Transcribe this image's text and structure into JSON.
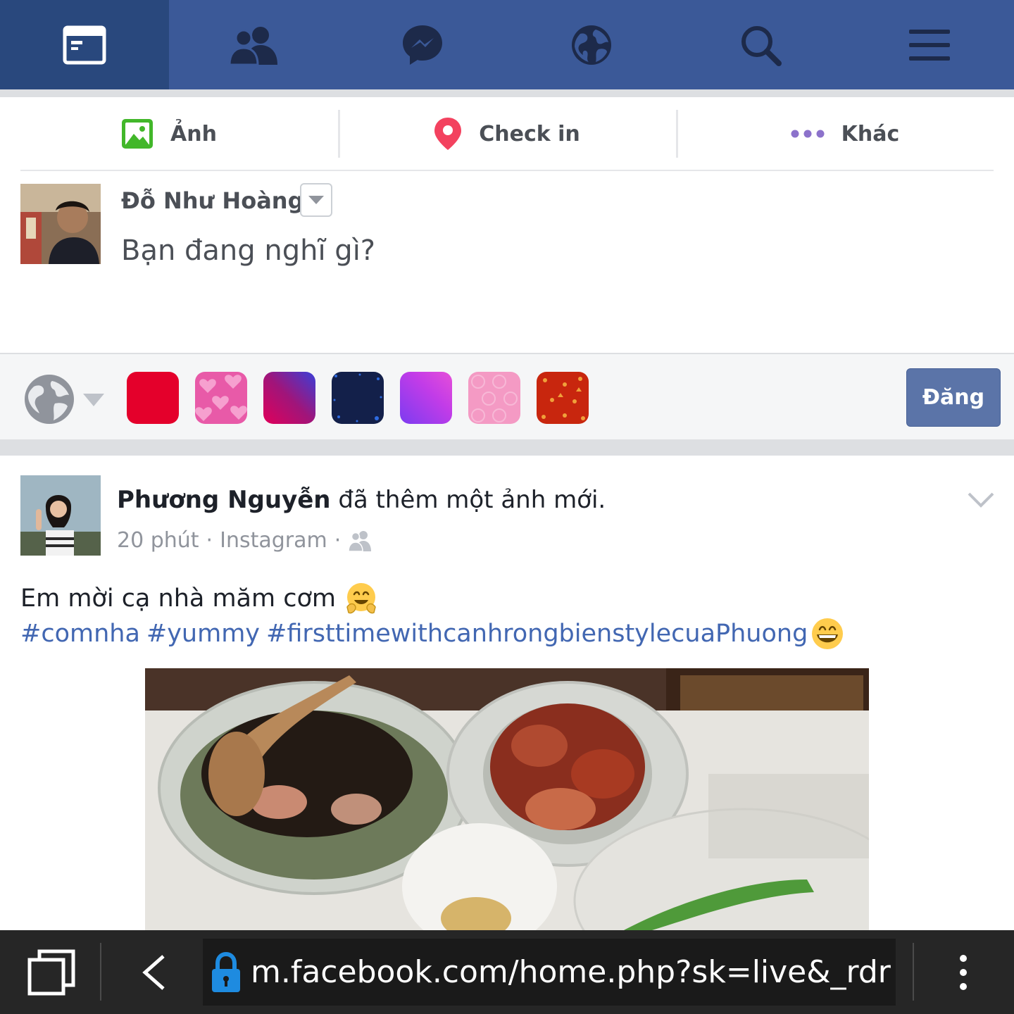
{
  "colors": {
    "brand": "#3b5998",
    "brand_active": "#29487d",
    "link": "#4267b2",
    "post_button": "#5b74a8"
  },
  "topnav": {
    "items": [
      {
        "icon": "news-feed-icon",
        "active": true
      },
      {
        "icon": "friends-icon",
        "active": false
      },
      {
        "icon": "messenger-icon",
        "active": false
      },
      {
        "icon": "globe-notifications-icon",
        "active": false
      },
      {
        "icon": "search-icon",
        "active": false
      },
      {
        "icon": "menu-icon",
        "active": false
      }
    ]
  },
  "composer": {
    "actions": {
      "photo_label": "Ảnh",
      "checkin_label": "Check in",
      "more_label": "Khác"
    },
    "user_name": "Đỗ Như Hoàng",
    "prompt": "Bạn đang nghĩ gì?",
    "post_label": "Đăng",
    "backgrounds": [
      "red",
      "pink-hearts",
      "purple-magenta-gradient",
      "dark-navy-sparkle",
      "violet-gradient",
      "pink-pattern",
      "red-pattern"
    ]
  },
  "post": {
    "author": "Phương Nguyễn",
    "action": "đã thêm một ảnh mới.",
    "time": "20 phút",
    "source": "Instagram",
    "separator": "·",
    "text": "Em mời cạ nhà măm cơm",
    "hashtags": [
      "#comnha",
      "#yummy",
      "#firsttimewithcanhrongbienstylecuaPhuong"
    ]
  },
  "browser": {
    "url": "m.facebook.com/home.php?sk=live&_rdr"
  }
}
